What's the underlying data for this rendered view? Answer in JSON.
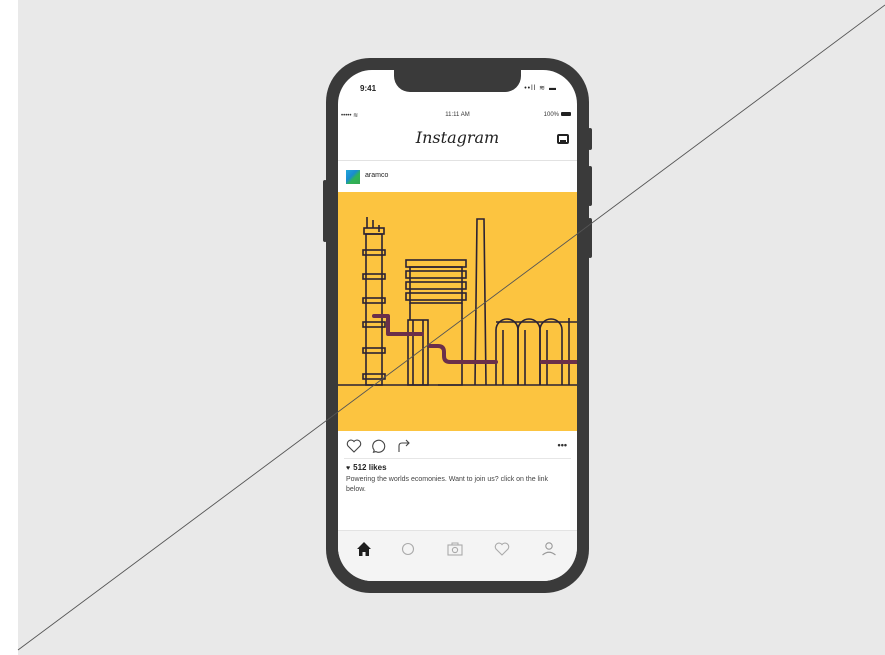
{
  "os_status": {
    "time": "9:41",
    "icons": "••ll ≋ ▬"
  },
  "app_status": {
    "carrier": "•••••  ≋",
    "time": "11:11 AM",
    "battery": "100%"
  },
  "app": {
    "title": "Instagram"
  },
  "post": {
    "username": "aramco",
    "likes": "512  likes",
    "caption": "Powering the worlds ecomonies. Want to join us? click on the link below.",
    "more": "•••"
  },
  "colors": {
    "canvas": "#e9e9e9",
    "phone": "#3a3a3a",
    "post_bg": "#fcc440",
    "pipe": "#6b2f4a",
    "line": "#2b2233"
  },
  "icons": {
    "actions": [
      "heart-icon",
      "comment-icon",
      "share-icon",
      "more-icon"
    ],
    "tabs": [
      "home-icon",
      "search-icon",
      "camera-icon",
      "activity-heart-icon",
      "profile-icon"
    ]
  }
}
